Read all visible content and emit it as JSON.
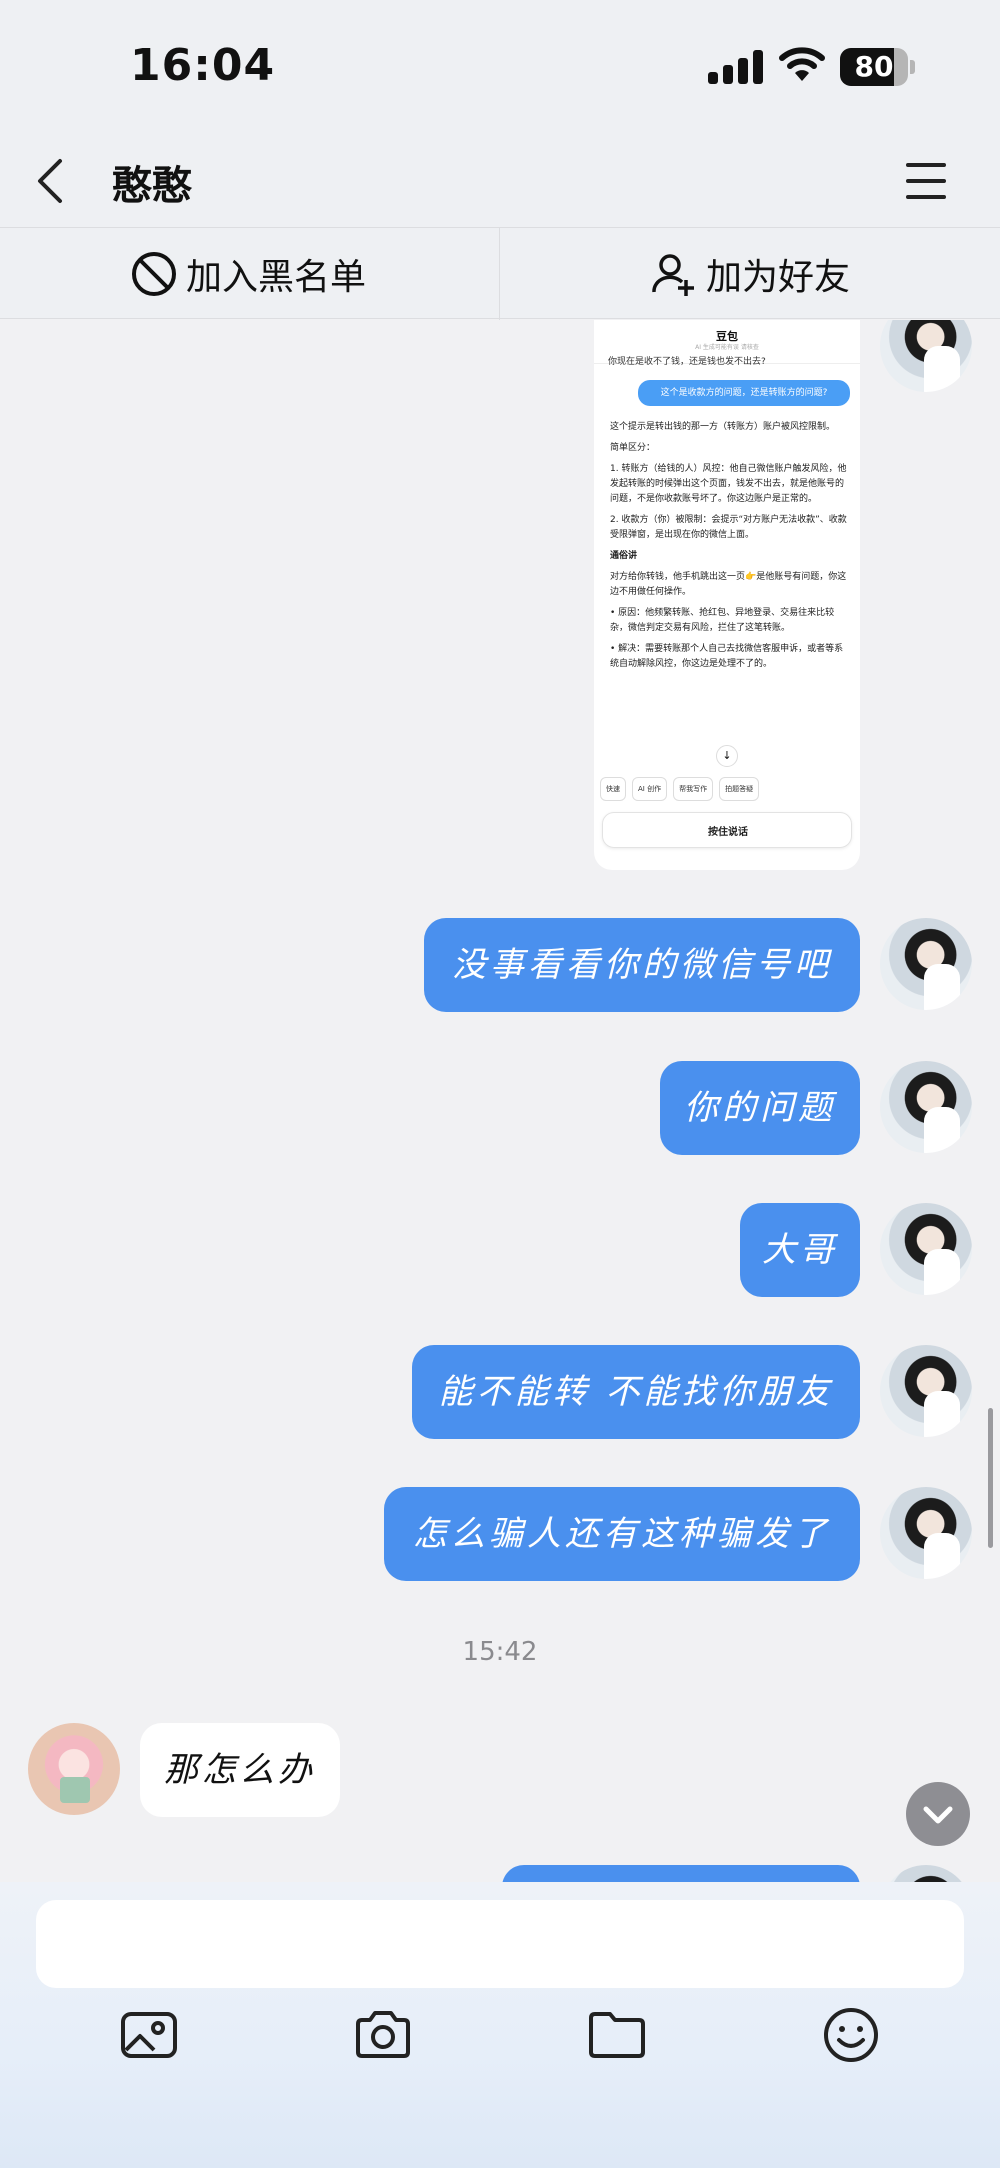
{
  "status_bar": {
    "time": "16:04",
    "battery": "80",
    "battery_level": 0.8
  },
  "header": {
    "contact_name": "憨憨"
  },
  "actions": {
    "blacklist_label": "加入黑名单",
    "add_friend_label": "加为好友"
  },
  "screenshot": {
    "app_title": "豆包",
    "app_subtitle": "AI 生成可能有误 请核查",
    "prev_line": "你现在是收不了钱，还是钱也发不出去?",
    "question": "这个是收款方的问题，还是转账方的问题?",
    "p1": "这个提示是转出钱的那一方（转账方）账户被风控限制。",
    "p2": "简单区分：",
    "item1": "1. 转账方（给钱的人）风控：他自己微信账户触发风险，他发起转账的时候弹出这个页面，钱发不出去，就是他账号的问题，不是你收款账号坏了。你这边账户是正常的。",
    "item2": "2. 收款方（你）被限制：会提示“对方账户无法收款”、收款受限弹窗，是出现在你的微信上面。",
    "heading": "通俗讲",
    "p3": "对方给你转钱，他手机跳出这一页👉是他账号有问题，你这边不用做任何操作。",
    "bullet1": "• 原因：他频繁转账、抢红包、异地登录、交易往来比较杂，微信判定交易有风险，拦住了这笔转账。",
    "bullet2": "• 解决：需要转账那个人自己去找微信客服申诉，或者等系统自动解除风控，你这边是处理不了的。",
    "chips": [
      "快速",
      "AI 创作",
      "帮我写作",
      "拍题答疑"
    ],
    "input_label": "按住说话"
  },
  "messages": [
    {
      "from": "me",
      "text": "没事看看你的微信号吧"
    },
    {
      "from": "me",
      "text": "你的问题"
    },
    {
      "from": "me",
      "text": "大哥"
    },
    {
      "from": "me",
      "text": "能不能转 不能找你朋友"
    },
    {
      "from": "me",
      "text": "怎么骗人还有这种骗发了"
    },
    {
      "from": "other",
      "text": "那怎么办"
    }
  ],
  "timestamp": "15:42",
  "input": {
    "value": "",
    "placeholder": ""
  },
  "toolbar": {
    "icons": [
      "image-icon",
      "camera-icon",
      "folder-icon",
      "emoji-icon"
    ]
  },
  "colors": {
    "bubble_me": "#4a90ee",
    "bubble_other": "#ffffff",
    "background": "#f1f1f3"
  }
}
